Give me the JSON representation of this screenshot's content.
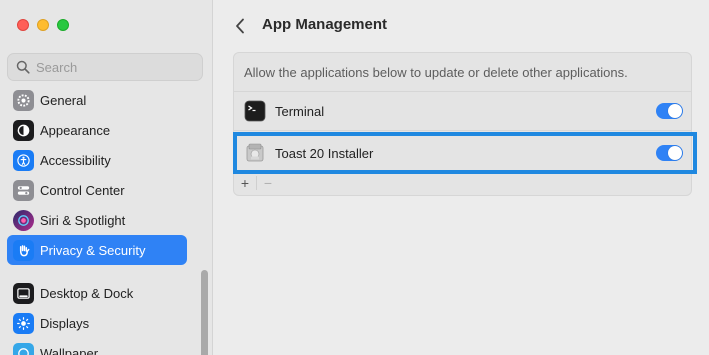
{
  "window": {
    "title": "App Management"
  },
  "search": {
    "placeholder": "Search"
  },
  "sidebar": {
    "items": [
      {
        "label": "General",
        "icon": "gear-icon",
        "color": "#8e8e93"
      },
      {
        "label": "Appearance",
        "icon": "appearance-icon",
        "color": "#1c1c1e"
      },
      {
        "label": "Accessibility",
        "icon": "accessibility-icon",
        "color": "#1a7cf5"
      },
      {
        "label": "Control Center",
        "icon": "control-center-icon",
        "color": "#8e8e93"
      },
      {
        "label": "Siri & Spotlight",
        "icon": "siri-icon",
        "color": "#7a3cdb"
      },
      {
        "label": "Privacy & Security",
        "icon": "hand-icon",
        "color": "#1a7cf5",
        "active": true
      },
      {
        "label": "Desktop & Dock",
        "icon": "dock-icon",
        "color": "#1c1c1e"
      },
      {
        "label": "Displays",
        "icon": "displays-icon",
        "color": "#1a7cf5"
      },
      {
        "label": "Wallpaper",
        "icon": "wallpaper-icon",
        "color": "#35a7e8"
      }
    ]
  },
  "panel": {
    "description": "Allow the applications below to update or delete other applications.",
    "apps": [
      {
        "name": "Terminal",
        "enabled": true,
        "icon": "terminal-icon"
      },
      {
        "name": "Toast 20 Installer",
        "enabled": true,
        "icon": "installer-icon"
      }
    ],
    "add_label": "+",
    "remove_label": "−"
  },
  "colors": {
    "accent": "#2f82f5",
    "highlight": "#1f88e0"
  }
}
